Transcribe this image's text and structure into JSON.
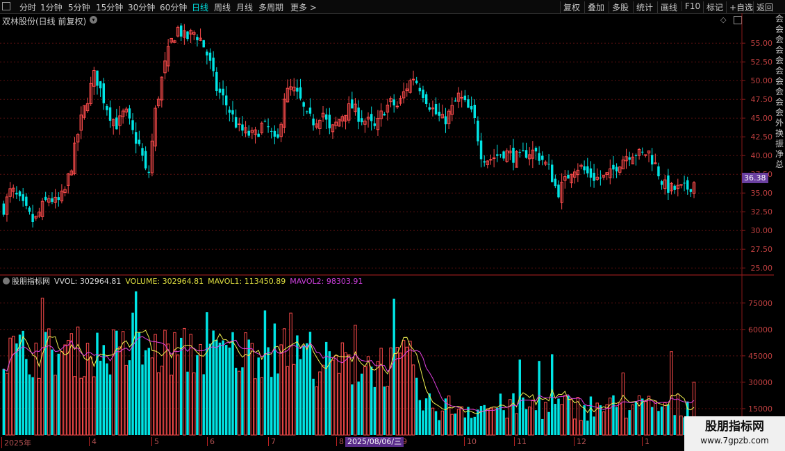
{
  "toolbar": {
    "periods": [
      "分时",
      "1分钟",
      "5分钟",
      "15分钟",
      "30分钟",
      "60分钟",
      "日线",
      "周线",
      "月线",
      "多周期",
      "更多 >"
    ],
    "active_index": 6,
    "tools": [
      "复权",
      "叠加",
      "多股",
      "统计",
      "画线",
      "F10",
      "标记",
      "+自选",
      "返回"
    ]
  },
  "stock": {
    "title": "双林股份(日线 前复权)"
  },
  "price_axis": {
    "ticks": [
      "55.00",
      "52.50",
      "50.00",
      "47.50",
      "45.00",
      "42.50",
      "40.00",
      "37.50",
      "35.00",
      "32.50",
      "30.00",
      "27.50",
      "25.00"
    ],
    "current": "36.38"
  },
  "volume_header": {
    "source": "股朋指标网",
    "vvol": "VVOL: 302964.81",
    "volume": "VOLUME: 302964.81",
    "mavol1": "MAVOL1: 113450.89",
    "mavol2": "MAVOL2: 98303.91"
  },
  "volume_axis": {
    "ticks": [
      "75000",
      "60000",
      "45000",
      "30000",
      "15000"
    ]
  },
  "date_axis": {
    "labels": [
      "2025年",
      "4",
      "5",
      "6",
      "7",
      "8",
      "9",
      "10",
      "11",
      "12",
      "1"
    ],
    "cursor_date": "2025/08/06/三"
  },
  "watermark": {
    "name": "股朋指标网",
    "url": "www.7gpzb.com"
  },
  "right_strip": {
    "chars": [
      "会",
      "会",
      "会",
      "会",
      "会",
      "会",
      "会",
      "会",
      "会",
      "会",
      "外",
      "换",
      "振",
      "净",
      "总"
    ]
  },
  "colors": {
    "up": "#ff4c4c",
    "down": "#00e5e5",
    "ma1": "#f0f050",
    "ma2": "#e040e0",
    "grid": "#5a1010",
    "active": "#00e0e0",
    "highlight": "#ffe000",
    "purple": "#d040e0"
  },
  "chart_data": {
    "type": "candlestick",
    "price_range": [
      24.0,
      59.0
    ],
    "volume_range": [
      0,
      82000
    ],
    "close_path": [
      33.0,
      35.5,
      34.0,
      32.5,
      31.0,
      33.0,
      34.5,
      33.5,
      35.0,
      39.0,
      44.0,
      47.5,
      51.0,
      48.0,
      45.5,
      44.0,
      46.0,
      43.0,
      41.0,
      36.5,
      46.0,
      51.0,
      55.0,
      57.0,
      55.5,
      56.5,
      55.5,
      53.0,
      49.0,
      47.5,
      45.5,
      43.5,
      43.0,
      42.5,
      44.0,
      43.5,
      41.0,
      48.0,
      49.0,
      47.5,
      45.0,
      44.5,
      46.0,
      43.0,
      44.5,
      46.0,
      46.5,
      45.0,
      44.5,
      43.5,
      46.0,
      47.0,
      46.5,
      49.0,
      50.5,
      49.0,
      47.0,
      45.5,
      44.5,
      46.0,
      48.0,
      46.5,
      45.0,
      40.0,
      39.5,
      40.0,
      40.5,
      40.0,
      39.5,
      40.5,
      40.5,
      39.5,
      38.0,
      35.0,
      36.5,
      38.5,
      38.5,
      37.5,
      37.0,
      37.0,
      37.5,
      39.0,
      40.0,
      40.5,
      40.0,
      40.5,
      38.5,
      36.0,
      35.5,
      35.5,
      35.5,
      36.38
    ]
  }
}
